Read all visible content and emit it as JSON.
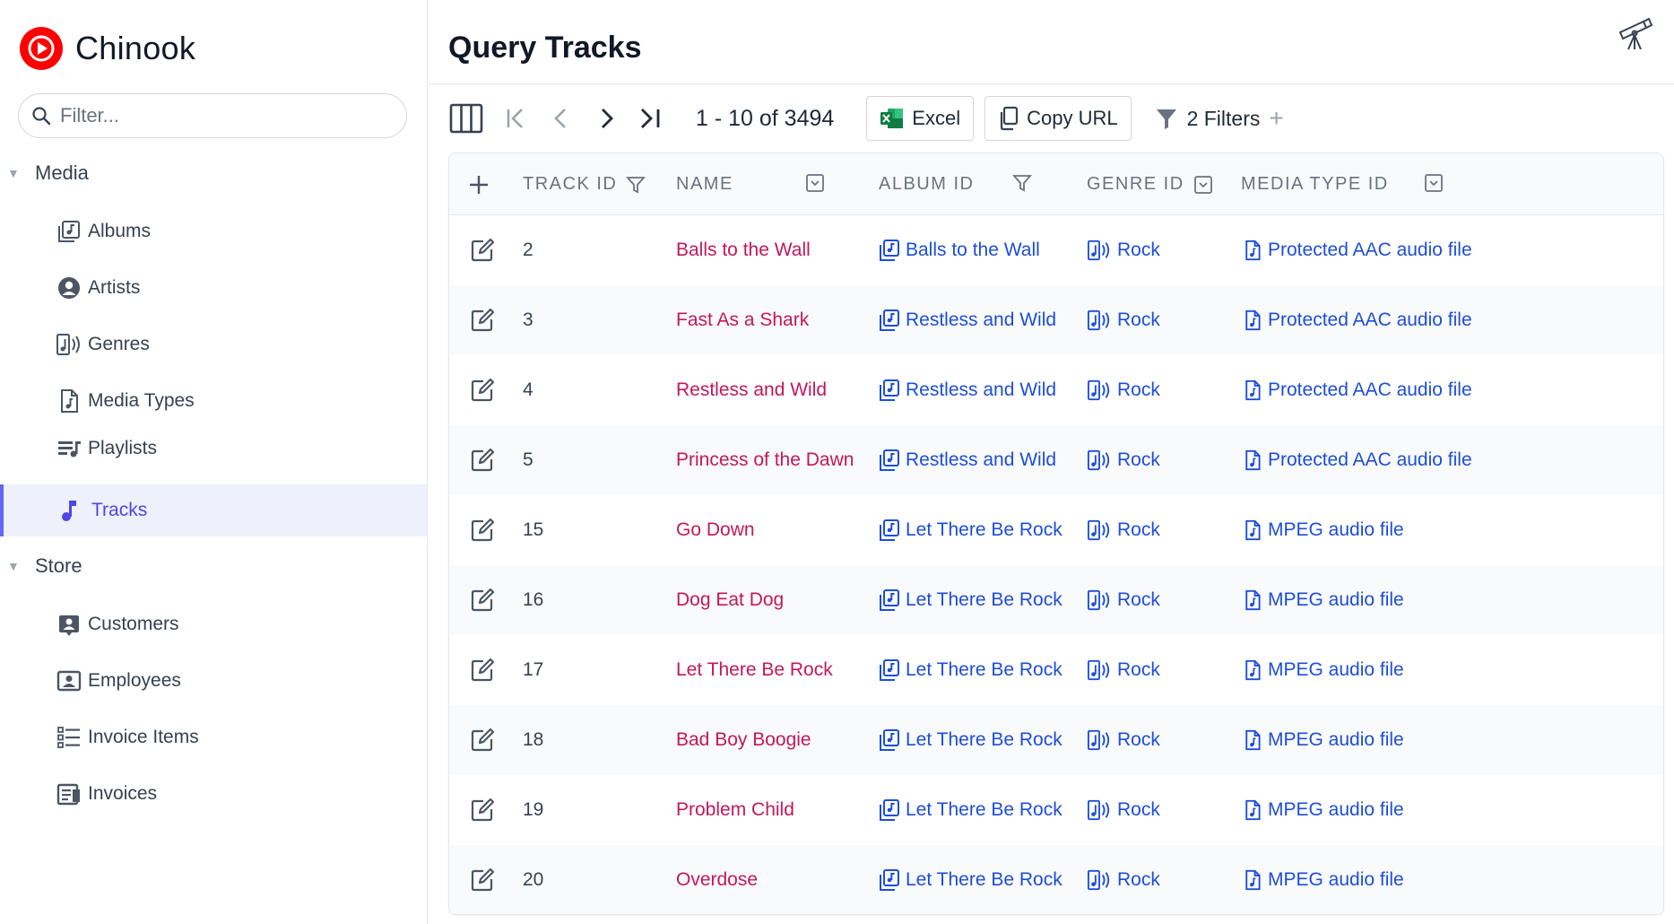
{
  "app": {
    "title": "Chinook"
  },
  "sidebar": {
    "filter_placeholder": "Filter...",
    "groups": [
      {
        "label": "Media",
        "items": [
          {
            "label": "Albums",
            "icon": "album-icon"
          },
          {
            "label": "Artists",
            "icon": "person-icon"
          },
          {
            "label": "Genres",
            "icon": "genre-icon"
          },
          {
            "label": "Media Types",
            "icon": "audio-file-icon"
          },
          {
            "label": "Playlists",
            "icon": "playlist-icon"
          },
          {
            "label": "Tracks",
            "icon": "music-note-icon",
            "active": true
          }
        ]
      },
      {
        "label": "Store",
        "items": [
          {
            "label": "Customers",
            "icon": "contact-icon"
          },
          {
            "label": "Employees",
            "icon": "badge-icon"
          },
          {
            "label": "Invoice Items",
            "icon": "list-icon"
          },
          {
            "label": "Invoices",
            "icon": "invoice-icon"
          }
        ]
      }
    ]
  },
  "main": {
    "title": "Query Tracks",
    "paging": "1 - 10 of 3494",
    "excel_label": "Excel",
    "copy_url_label": "Copy URL",
    "filters_label": "2 Filters",
    "filters_add": "+"
  },
  "table": {
    "columns": [
      "TRACK ID",
      "NAME",
      "ALBUM ID",
      "GENRE ID",
      "MEDIA TYPE ID"
    ],
    "rows": [
      {
        "id": "2",
        "name": "Balls to the Wall",
        "album": "Balls to the Wall",
        "genre": "Rock",
        "media": "Protected AAC audio file"
      },
      {
        "id": "3",
        "name": "Fast As a Shark",
        "album": "Restless and Wild",
        "genre": "Rock",
        "media": "Protected AAC audio file"
      },
      {
        "id": "4",
        "name": "Restless and Wild",
        "album": "Restless and Wild",
        "genre": "Rock",
        "media": "Protected AAC audio file"
      },
      {
        "id": "5",
        "name": "Princess of the Dawn",
        "album": "Restless and Wild",
        "genre": "Rock",
        "media": "Protected AAC audio file"
      },
      {
        "id": "15",
        "name": "Go Down",
        "album": "Let There Be Rock",
        "genre": "Rock",
        "media": "MPEG audio file"
      },
      {
        "id": "16",
        "name": "Dog Eat Dog",
        "album": "Let There Be Rock",
        "genre": "Rock",
        "media": "MPEG audio file"
      },
      {
        "id": "17",
        "name": "Let There Be Rock",
        "album": "Let There Be Rock",
        "genre": "Rock",
        "media": "MPEG audio file"
      },
      {
        "id": "18",
        "name": "Bad Boy Boogie",
        "album": "Let There Be Rock",
        "genre": "Rock",
        "media": "MPEG audio file"
      },
      {
        "id": "19",
        "name": "Problem Child",
        "album": "Let There Be Rock",
        "genre": "Rock",
        "media": "MPEG audio file"
      },
      {
        "id": "20",
        "name": "Overdose",
        "album": "Let There Be Rock",
        "genre": "Rock",
        "media": "MPEG audio file"
      }
    ]
  },
  "colors": {
    "brand": "#ff0000",
    "accent": "#4f46e5",
    "name_link": "#c2185b",
    "ref_link": "#1d4ed8",
    "excel": "#107c41"
  }
}
